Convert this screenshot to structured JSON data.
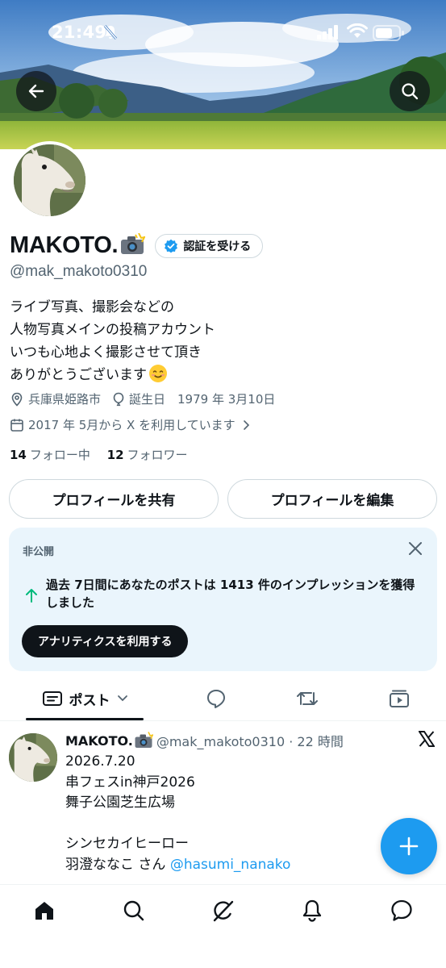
{
  "status_bar": {
    "time": "21:49"
  },
  "profile": {
    "display_name": "MAKOTO.",
    "name_emoji": "camera-with-flash",
    "verify_label": "認証を受ける",
    "handle": "@mak_makoto0310",
    "bio_lines": [
      "ライブ写真、撮影会などの",
      "人物写真メインの投稿アカウント",
      "いつも心地よく撮影させて頂き",
      "ありがとうございます"
    ],
    "bio_emoji": "smiling-face",
    "location": "兵庫県姫路市",
    "birthday": "誕生日　1979 年 3月10日",
    "joined": "2017 年 5月から X を利用しています",
    "following_count": "14",
    "following_label": "フォロー中",
    "followers_count": "12",
    "followers_label": "フォロワー"
  },
  "actions": {
    "share_label": "プロフィールを共有",
    "edit_label": "プロフィールを編集"
  },
  "analytics_card": {
    "label": "非公開",
    "message": "過去 7日間にあなたのポストは 1413 件のインプレッションを獲得しました",
    "button_label": "アナリティクスを利用する"
  },
  "tabs": {
    "posts_label": "ポスト",
    "icons": [
      "speech-bubble-icon",
      "repost-icon",
      "video-icon"
    ]
  },
  "post": {
    "author_name": "MAKOTO.",
    "handle_time": "@mak_makoto0310 · 22 時間",
    "lines": [
      "2026.7.20",
      "串フェスin神戸2026",
      "舞子公園芝生広場",
      "",
      "シンセカイヒーロー"
    ],
    "last_line_text": "羽澄ななこ さん ",
    "mention": "@hasumi_nanako"
  },
  "colors": {
    "accent": "#1d9bf0",
    "text": "#0f1419",
    "secondary_text": "#536471",
    "card_bg": "#eaf5fc",
    "border": "#cfd9de"
  }
}
